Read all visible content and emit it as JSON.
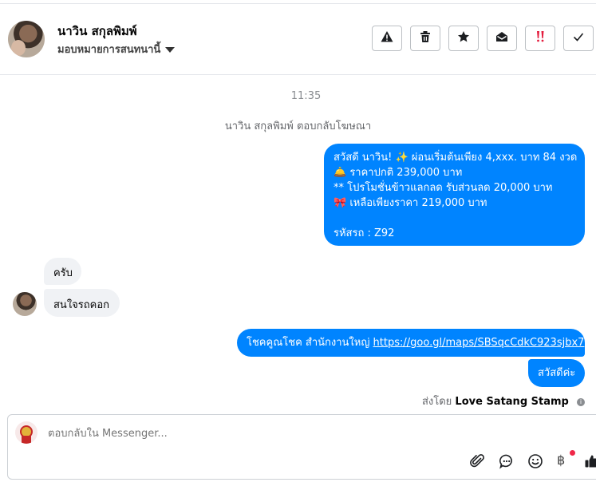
{
  "header": {
    "contact_name": "นาวิน สกุลพิมพ์",
    "assign_label": "มอบหมายการสนทนานี้",
    "buttons": {
      "warning_icon": "warning-icon",
      "delete_icon": "trash-icon",
      "star_icon": "star-icon",
      "read_icon": "envelope-open-icon",
      "follow_up_icon": "alert-icon",
      "done_icon": "check-icon"
    }
  },
  "conversation": {
    "timestamp": "11:35",
    "ad_reply_note": "นาวิน สกุลพิมพ์ ตอบกลับโฆษณา",
    "messages": [
      {
        "from": "page",
        "lines": [
          "สวัสดี นาวิน! ✨  ผ่อนเริ่มต้นเพียง 4,xxx. บาท 84 งวด",
          "🛎️ ราคาปกติ 239,000 บาท",
          "** โปรโมชั่นข้าวแลกลด รับส่วนลด 20,000 บาท",
          "🎀  เหลือเพียงราคา 219,000 บาท",
          "",
          " รหัสรถ : Z92"
        ]
      },
      {
        "from": "customer",
        "text": "ครับ"
      },
      {
        "from": "customer",
        "text": "สนใจรถคอก"
      },
      {
        "from": "page",
        "prefix": "โชคคูณโชค สำนักงานใหญ่ ",
        "link": "https://goo.gl/maps/SBSqcCdkC923sjbx7"
      },
      {
        "from": "page",
        "text": "สวัสดีค่ะ"
      }
    ],
    "sent_by_label": "ส่งโดย",
    "sent_by_name": "Love Satang Stamp"
  },
  "composer": {
    "placeholder": "ตอบกลับใน Messenger...",
    "baht_symbol": "฿"
  },
  "colors": {
    "bubble_outgoing": "#0084ff",
    "bubble_incoming": "#f0f2f5",
    "follow_up_red": "#e41e3f"
  }
}
